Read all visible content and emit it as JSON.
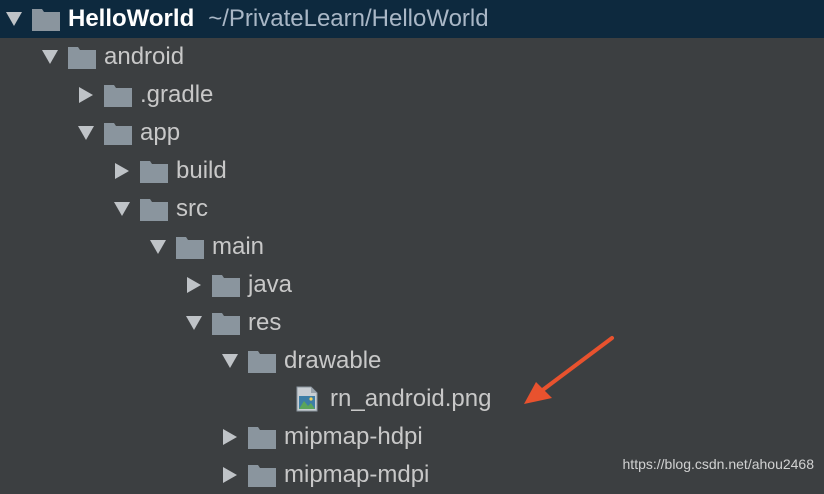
{
  "tree": {
    "nodes": [
      {
        "name": "root",
        "label": "HelloWorld",
        "path": "~/PrivateLearn/HelloWorld",
        "expanded": true,
        "type": "folder",
        "depth": 0
      },
      {
        "name": "android",
        "label": "android",
        "expanded": true,
        "type": "folder",
        "depth": 1
      },
      {
        "name": "gradle",
        "label": ".gradle",
        "expanded": false,
        "type": "folder",
        "depth": 2
      },
      {
        "name": "app",
        "label": "app",
        "expanded": true,
        "type": "folder",
        "depth": 2
      },
      {
        "name": "build",
        "label": "build",
        "expanded": false,
        "type": "folder",
        "depth": 3
      },
      {
        "name": "src",
        "label": "src",
        "expanded": true,
        "type": "folder",
        "depth": 3
      },
      {
        "name": "main",
        "label": "main",
        "expanded": true,
        "type": "folder",
        "depth": 4
      },
      {
        "name": "java",
        "label": "java",
        "expanded": false,
        "type": "folder",
        "depth": 5
      },
      {
        "name": "res",
        "label": "res",
        "expanded": true,
        "type": "folder",
        "depth": 5
      },
      {
        "name": "drawable",
        "label": "drawable",
        "expanded": true,
        "type": "folder",
        "depth": 6
      },
      {
        "name": "rn-android-png",
        "label": "rn_android.png",
        "type": "image-file",
        "depth": 7
      },
      {
        "name": "mipmap-hdpi",
        "label": "mipmap-hdpi",
        "expanded": false,
        "type": "folder",
        "depth": 6
      },
      {
        "name": "mipmap-mdpi",
        "label": "mipmap-mdpi",
        "expanded": false,
        "type": "folder",
        "depth": 6
      }
    ]
  },
  "watermark": "https://blog.csdn.net/ahou2468",
  "colors": {
    "background": "#3c3f41",
    "selected_row": "#0d293e",
    "folder": "#8a959e",
    "arrow": "#bfc3c7",
    "annotation_arrow": "#e8522e"
  }
}
